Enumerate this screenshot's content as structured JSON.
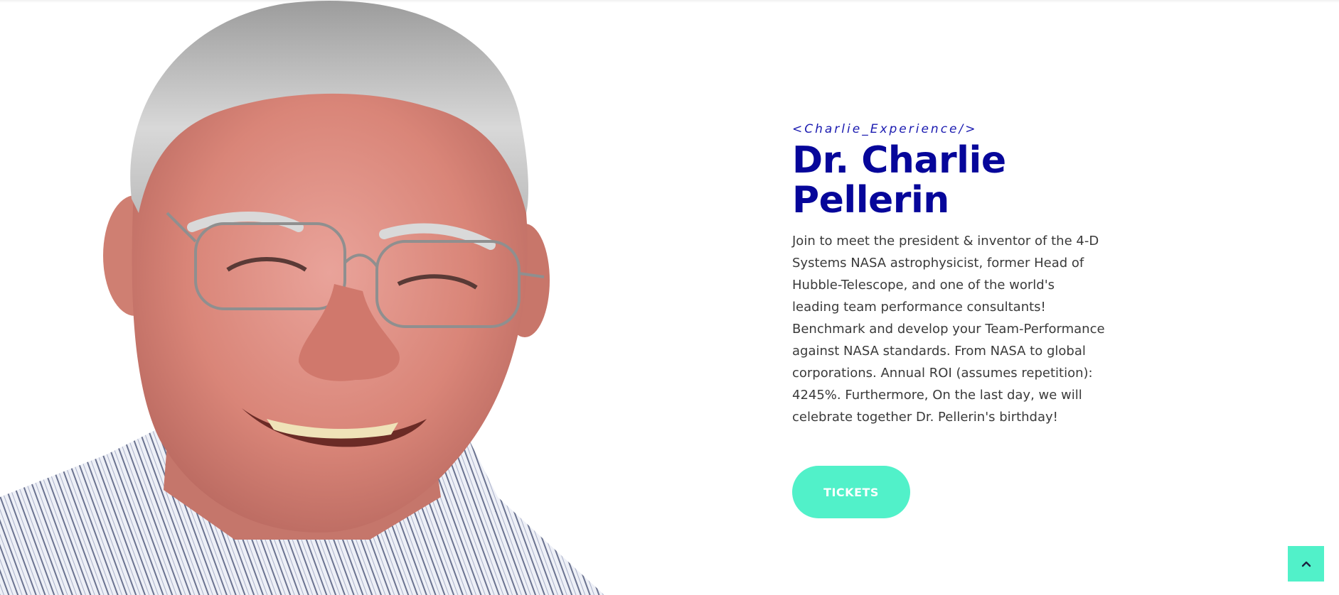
{
  "speaker": {
    "eyebrow": "<Charlie_Experience/>",
    "name_line1": "Dr. Charlie",
    "name_line2": "Pellerin",
    "description": "Join to meet the president & inventor of the 4-D Systems NASA astrophysicist, former Head of Hubble-Telescope, and one of the world's leading team performance consultants! Benchmark and develop your Team-Performance against NASA standards. From NASA to global corporations. Annual ROI (assumes repetition): 4245%. Furthermore, On the last day, we will celebrate together Dr. Pellerin's birthday!"
  },
  "actions": {
    "tickets_label": "TICKETS",
    "scroll_top_icon": "chevron-up-icon"
  },
  "colors": {
    "accent": "#51f1c9",
    "heading": "#06069a",
    "body_text": "#3a3a3a"
  }
}
